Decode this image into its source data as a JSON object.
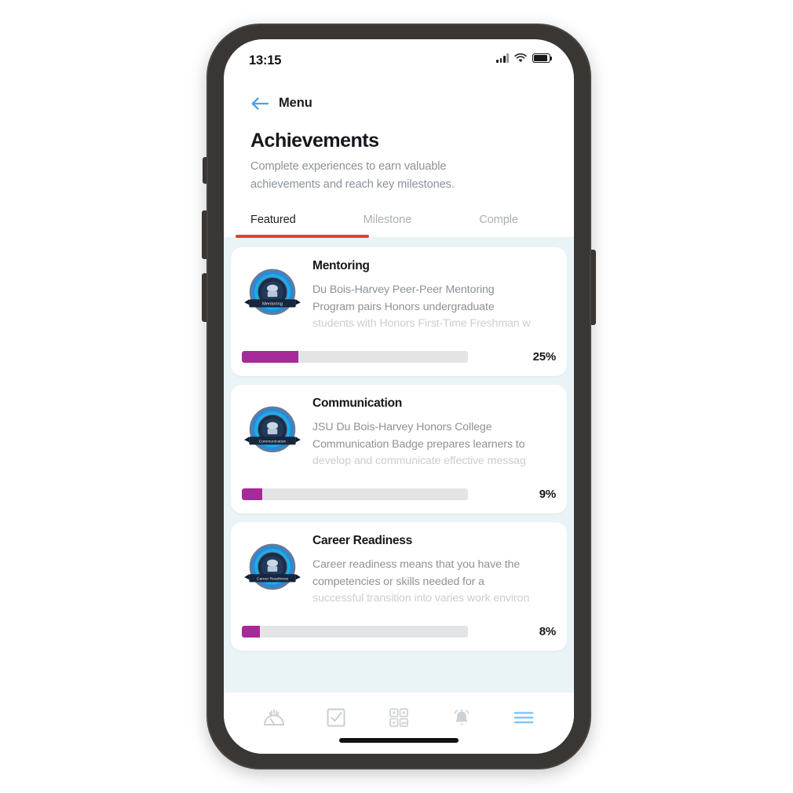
{
  "status_bar": {
    "time": "13:15",
    "signal_icon": "cellular-signal-icon",
    "wifi_icon": "wifi-icon",
    "battery_icon": "battery-icon"
  },
  "nav": {
    "back_icon": "back-arrow-icon",
    "back_label": "Menu"
  },
  "header": {
    "title": "Achievements",
    "subtitle": "Complete experiences to earn valuable achievements and reach key milestones."
  },
  "tabs": [
    {
      "label": "Featured",
      "active": true
    },
    {
      "label": "Milestone",
      "active": false
    },
    {
      "label": "Comple",
      "active": false
    }
  ],
  "cards": [
    {
      "badge_icon": "mentoring-badge-icon",
      "badge_ribbon": "Mentoring",
      "title": "Mentoring",
      "desc_line1": "Du Bois-Harvey Peer-Peer Mentoring",
      "desc_line2": "Program pairs Honors undergraduate",
      "desc_line3": "students with Honors First-Time Freshman w",
      "progress": 25,
      "progress_label": "25%"
    },
    {
      "badge_icon": "communication-badge-icon",
      "badge_ribbon": "Communication",
      "title": "Communication",
      "desc_line1": "JSU Du Bois-Harvey Honors College",
      "desc_line2": "Communication Badge prepares learners to",
      "desc_line3": "develop and communicate effective messag",
      "progress": 9,
      "progress_label": "9%"
    },
    {
      "badge_icon": "career-readiness-badge-icon",
      "badge_ribbon": "Career Readiness",
      "title": "Career Readiness",
      "desc_line1": "Career readiness means that you have the",
      "desc_line2": "competencies or skills needed for a",
      "desc_line3": "successful transition into varies work environ",
      "progress": 8,
      "progress_label": "8%"
    }
  ],
  "bottom_nav": [
    {
      "icon": "dashboard-gauge-icon",
      "active": false
    },
    {
      "icon": "checkbox-task-icon",
      "active": false
    },
    {
      "icon": "qr-code-icon",
      "active": false
    },
    {
      "icon": "bell-notification-icon",
      "active": false
    },
    {
      "icon": "hamburger-menu-icon",
      "active": true
    }
  ],
  "colors": {
    "accent_red": "#ec3c2d",
    "progress_magenta": "#a62a97",
    "active_blue": "#7ec8f5",
    "link_blue": "#4aa3f0",
    "list_background": "#eaf3f5",
    "phone_frame": "#3a3634"
  }
}
